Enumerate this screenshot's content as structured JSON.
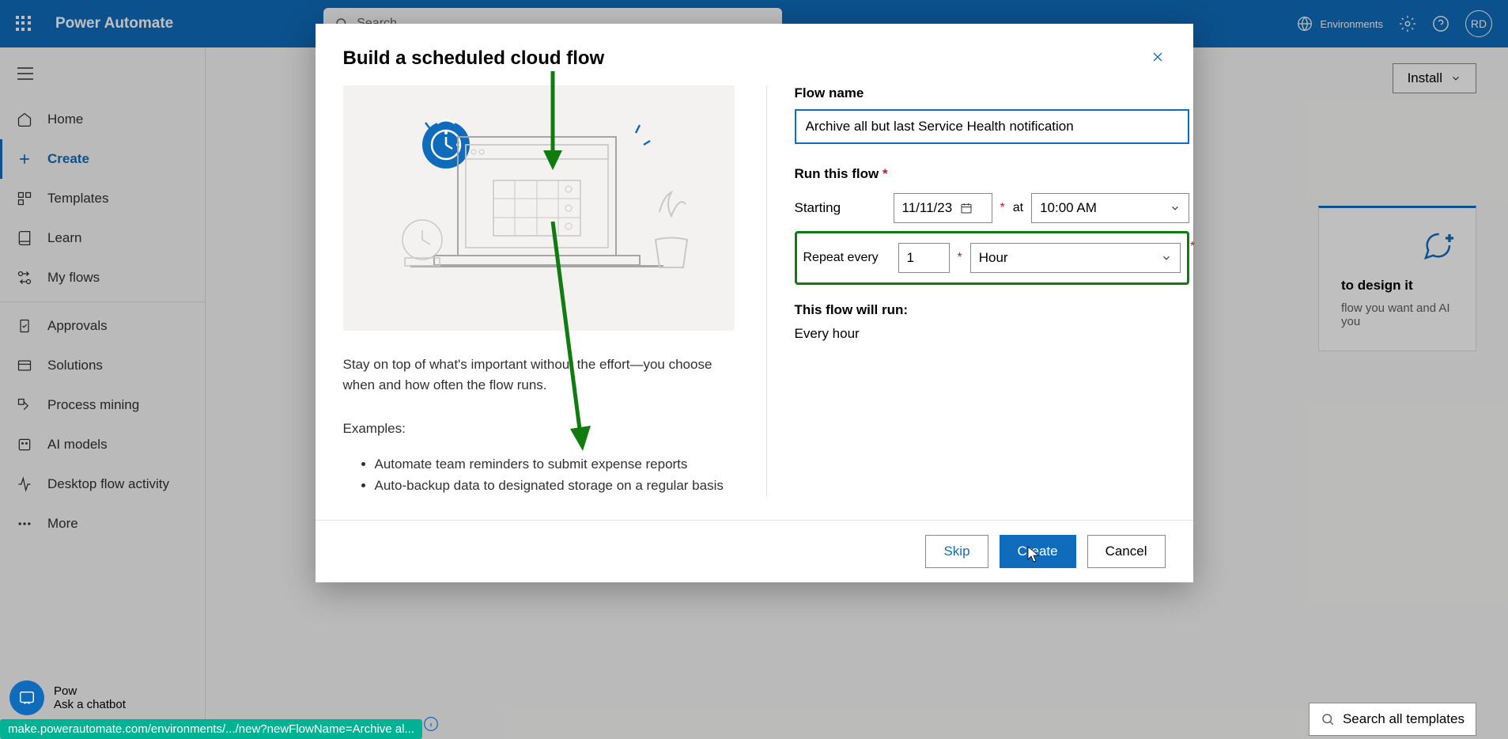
{
  "header": {
    "brand": "Power Automate",
    "search_placeholder": "Search",
    "env_label": "Environments",
    "avatar_initials": "RD"
  },
  "sidebar": {
    "items": [
      {
        "label": "Home"
      },
      {
        "label": "Create"
      },
      {
        "label": "Templates"
      },
      {
        "label": "Learn"
      },
      {
        "label": "My flows"
      },
      {
        "label": "Approvals"
      },
      {
        "label": "Solutions"
      },
      {
        "label": "Process mining"
      },
      {
        "label": "AI models"
      },
      {
        "label": "Desktop flow activity"
      },
      {
        "label": "More"
      }
    ]
  },
  "main": {
    "install_label": "Install",
    "card": {
      "title": "to design it",
      "desc": "flow you want and AI you"
    },
    "search_templates": "Search all templates"
  },
  "modal": {
    "title": "Build a scheduled cloud flow",
    "desc": "Stay on top of what's important without the effort—you choose when and how often the flow runs.",
    "examples_label": "Examples:",
    "examples": [
      "Automate team reminders to submit expense reports",
      "Auto-backup data to designated storage on a regular basis"
    ],
    "flow_name_label": "Flow name",
    "flow_name_value": "Archive all but last Service Health notification",
    "run_label": "Run this flow",
    "starting_label": "Starting",
    "at_label": "at",
    "date_value": "11/11/23",
    "time_value": "10:00 AM",
    "repeat_label": "Repeat every",
    "repeat_num": "1",
    "repeat_unit": "Hour",
    "will_run_label": "This flow will run:",
    "will_run_value": "Every hour",
    "skip": "Skip",
    "create": "Create",
    "cancel": "Cancel"
  },
  "chatbot": {
    "label": "Ask a chatbot",
    "prefix": "Pow"
  },
  "status": "make.powerautomate.com/environments/.../new?newFlowName=Archive al..."
}
